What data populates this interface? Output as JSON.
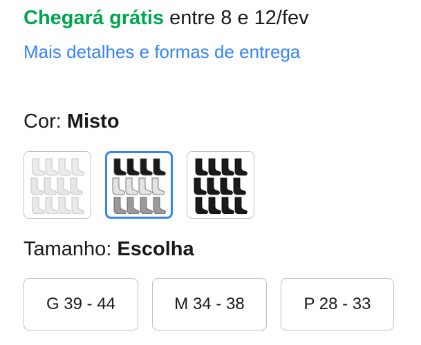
{
  "shipping": {
    "free_label": "Chegará grátis",
    "date_text": " entre 8 e 12/fev"
  },
  "details_link": "Mais detalhes e formas de entrega",
  "color": {
    "label": "Cor: ",
    "value": "Misto",
    "options": [
      {
        "name": "white-socks-pack",
        "rows": [
          "#ececec",
          "#e6e6e6",
          "#e9e9e9"
        ],
        "stroke": "#b5b5b5",
        "selected": false
      },
      {
        "name": "mixed-socks-pack",
        "rows": [
          "#1a1a1a",
          "#e2e2e2",
          "#9a9a9a"
        ],
        "stroke": "#555555",
        "selected": true
      },
      {
        "name": "black-socks-pack",
        "rows": [
          "#1a1a1a",
          "#1a1a1a",
          "#1a1a1a"
        ],
        "stroke": "#000000",
        "selected": false
      }
    ]
  },
  "size": {
    "label": "Tamanho: ",
    "value": "Escolha",
    "options": [
      "G 39 - 44",
      "M 34 - 38",
      "P 28 - 33"
    ]
  },
  "colors": {
    "free_green": "#00a650",
    "link_blue": "#3483fa",
    "selected_border": "#3483fa"
  }
}
